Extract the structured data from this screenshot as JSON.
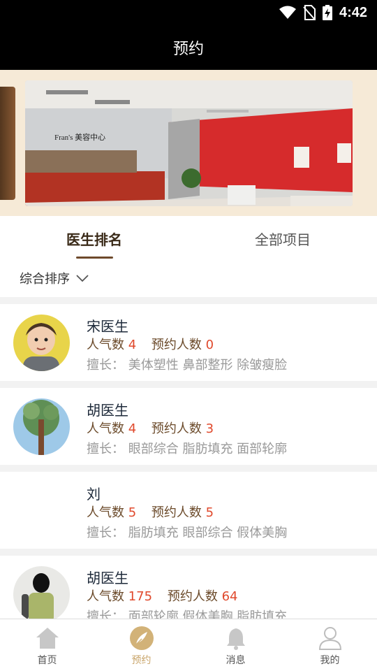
{
  "status_bar": {
    "time": "4:42",
    "icons": [
      "wifi-icon",
      "no-sim-icon",
      "battery-charging-icon"
    ]
  },
  "header": {
    "title": "预约"
  },
  "tabs": [
    {
      "label": "医生排名",
      "active": true
    },
    {
      "label": "全部项目",
      "active": false
    }
  ],
  "sort": {
    "label": "综合排序"
  },
  "banner": {
    "sign_text": "Fran's 美容中心"
  },
  "doctors": [
    {
      "name": "宋医生",
      "popularity_label": "人气数",
      "popularity": "4",
      "appointments_label": "预约人数",
      "appointments": "0",
      "specialty_label": "擅长：",
      "specialties": "美体塑性 鼻部整形 除皱瘦脸"
    },
    {
      "name": "胡医生",
      "popularity_label": "人气数",
      "popularity": "4",
      "appointments_label": "预约人数",
      "appointments": "3",
      "specialty_label": "擅长：",
      "specialties": "眼部综合 脂肪填充 面部轮廓"
    },
    {
      "name": "刘",
      "popularity_label": "人气数",
      "popularity": "5",
      "appointments_label": "预约人数",
      "appointments": "5",
      "specialty_label": "擅长：",
      "specialties": "脂肪填充 眼部综合 假体美胸"
    },
    {
      "name": "胡医生",
      "popularity_label": "人气数",
      "popularity": "175",
      "appointments_label": "预约人数",
      "appointments": "64",
      "specialty_label": "擅长：",
      "specialties": "面部轮廓 假体美胸 脂肪填充"
    }
  ],
  "bottom_nav": [
    {
      "label": "首页",
      "icon": "home-icon",
      "active": false
    },
    {
      "label": "预约",
      "icon": "feather-icon",
      "active": true
    },
    {
      "label": "消息",
      "icon": "bell-icon",
      "active": false
    },
    {
      "label": "我的",
      "icon": "person-icon",
      "active": false
    }
  ],
  "colors": {
    "accent": "#c9a56a",
    "highlight": "#e0492c",
    "banner_bg": "#f6ead7",
    "tab_text": "#3a2a18"
  }
}
